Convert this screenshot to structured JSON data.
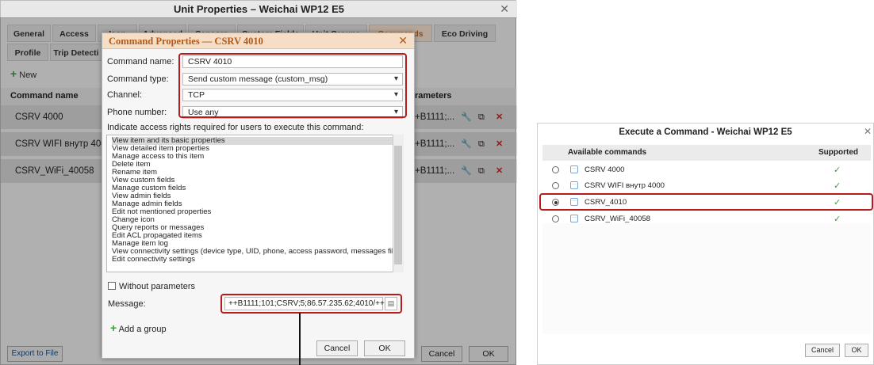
{
  "unit_window": {
    "title": "Unit Properties – Weichai WP12 E5",
    "close_icon": "close-icon",
    "tabs_row1": [
      "General",
      "Access",
      "Icon",
      "Advanced",
      "Sensors",
      "Custom Fields",
      "Unit Groups",
      "Commands",
      "Eco Driving"
    ],
    "tabs_row2": [
      "Profile",
      "Trip Detecti"
    ],
    "active_tab": "Commands",
    "new_label": "New",
    "col_command_name": "Command name",
    "col_parameters": "rameters",
    "rows": [
      {
        "name": "CSRV 4000",
        "params": ""
      },
      {
        "name": "CSRV WIFI внутр 4000",
        "params": "+B1111;..."
      },
      {
        "name": "CSRV_WiFi_40058",
        "params": "+B1111;..."
      }
    ],
    "first_row_params": "+B1111;...",
    "export_label": "Export to File",
    "cancel_label": "Cancel",
    "ok_label": "OK"
  },
  "command_properties": {
    "title": "Command Properties — CSRV 4010",
    "name_label": "Command name:",
    "name_value": "CSRV 4010",
    "type_label": "Command type:",
    "type_value": "Send custom message (custom_msg)",
    "channel_label": "Channel:",
    "channel_value": "TCP",
    "phone_label": "Phone number:",
    "phone_value": "Use any",
    "rights_label": "Indicate access rights required for users to execute this command:",
    "rights": [
      "View item and its basic properties",
      "View detailed item properties",
      "Manage access to this item",
      "Delete item",
      "Rename item",
      "View custom fields",
      "Manage custom fields",
      "View admin fields",
      "Manage admin fields",
      "Edit not mentioned properties",
      "Change icon",
      "Query reports or messages",
      "Edit ACL propagated items",
      "Manage item log",
      "View connectivity settings (device type, UID, phone, access password, messages filt",
      "Edit connectivity settings"
    ],
    "without_params_label": "Without parameters",
    "message_label": "Message:",
    "message_value": "++B1111;101;CSRV;5;86.57.235.62;4010/++",
    "add_group_label": "Add a group",
    "cancel_label": "Cancel",
    "ok_label": "OK"
  },
  "execute_window": {
    "title": "Execute a Command - Weichai WP12 E5",
    "col_available": "Available commands",
    "col_supported": "Supported",
    "commands": [
      {
        "name": "CSRV 4000",
        "selected": false
      },
      {
        "name": "CSRV WIFI внутр 4000",
        "selected": false
      },
      {
        "name": "CSRV_4010",
        "selected": true
      },
      {
        "name": "CSRV_WiFi_40058",
        "selected": false
      }
    ],
    "supported_mark": "✓",
    "cancel_label": "Cancel",
    "ok_label": "OK"
  },
  "colors": {
    "accent_orange": "#c46b1f",
    "highlight_red": "#b71c1c",
    "supported_green": "#3aa137"
  }
}
